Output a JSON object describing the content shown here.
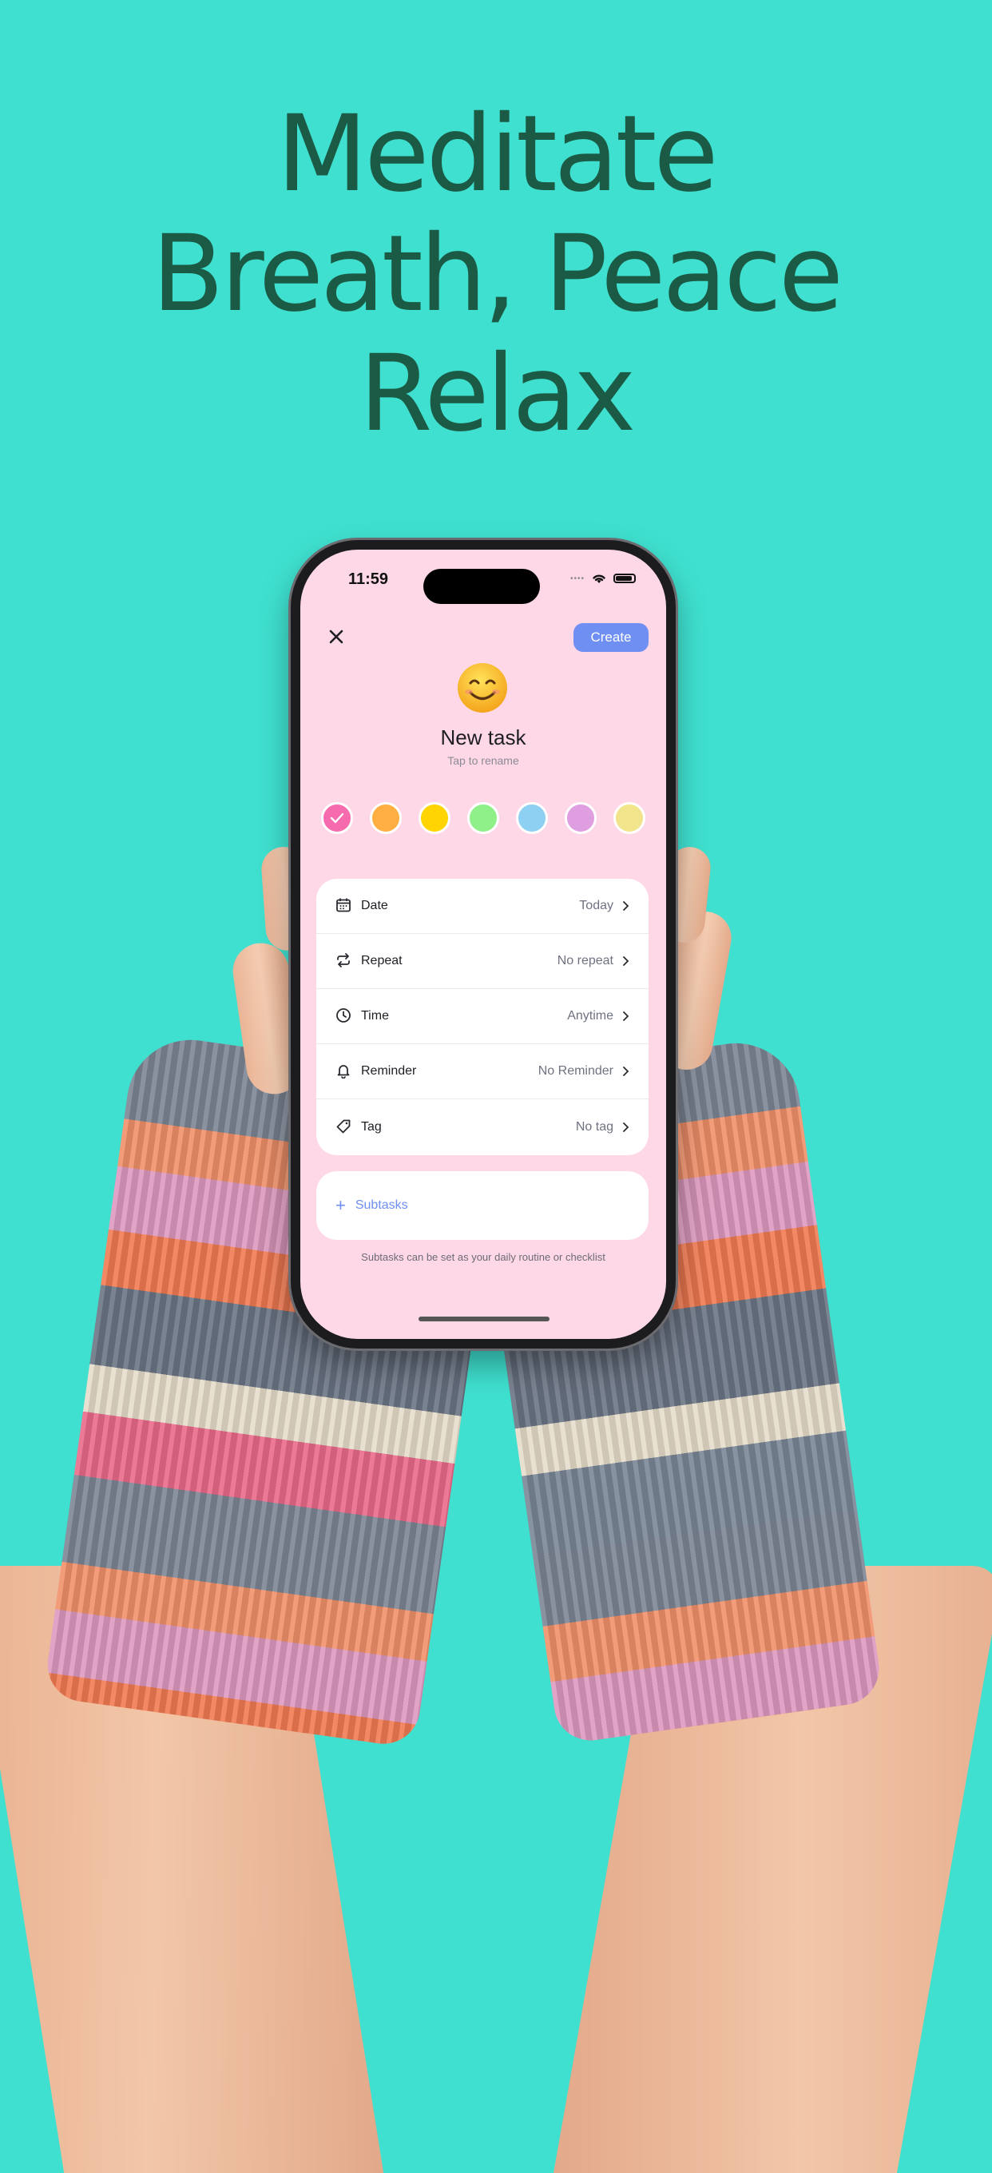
{
  "headline": {
    "line1": "Meditate",
    "line2": "Breath, Peace",
    "line3": "Relax"
  },
  "status_bar": {
    "time": "11:59"
  },
  "header": {
    "create_label": "Create"
  },
  "task": {
    "emoji": "smiling-face",
    "title": "New task",
    "subtitle": "Tap to rename"
  },
  "colors": {
    "accent": "#6f8ff2",
    "background": "#3fe0cf",
    "screen_background": "#ffd8e8",
    "headline": "#1b5a45"
  },
  "swatches": [
    {
      "color": "#f66aae",
      "selected": true
    },
    {
      "color": "#ffae42",
      "selected": false
    },
    {
      "color": "#ffd400",
      "selected": false
    },
    {
      "color": "#8ff08a",
      "selected": false
    },
    {
      "color": "#8ed0f2",
      "selected": false
    },
    {
      "color": "#df9ee0",
      "selected": false
    },
    {
      "color": "#f2e48a",
      "selected": false
    }
  ],
  "settings": [
    {
      "icon": "calendar-icon",
      "label": "Date",
      "value": "Today"
    },
    {
      "icon": "repeat-icon",
      "label": "Repeat",
      "value": "No repeat"
    },
    {
      "icon": "clock-icon",
      "label": "Time",
      "value": "Anytime"
    },
    {
      "icon": "bell-icon",
      "label": "Reminder",
      "value": "No Reminder"
    },
    {
      "icon": "tag-icon",
      "label": "Tag",
      "value": "No tag"
    }
  ],
  "subtasks": {
    "label": "Subtasks",
    "hint": "Subtasks can be set as your daily routine or checklist"
  }
}
